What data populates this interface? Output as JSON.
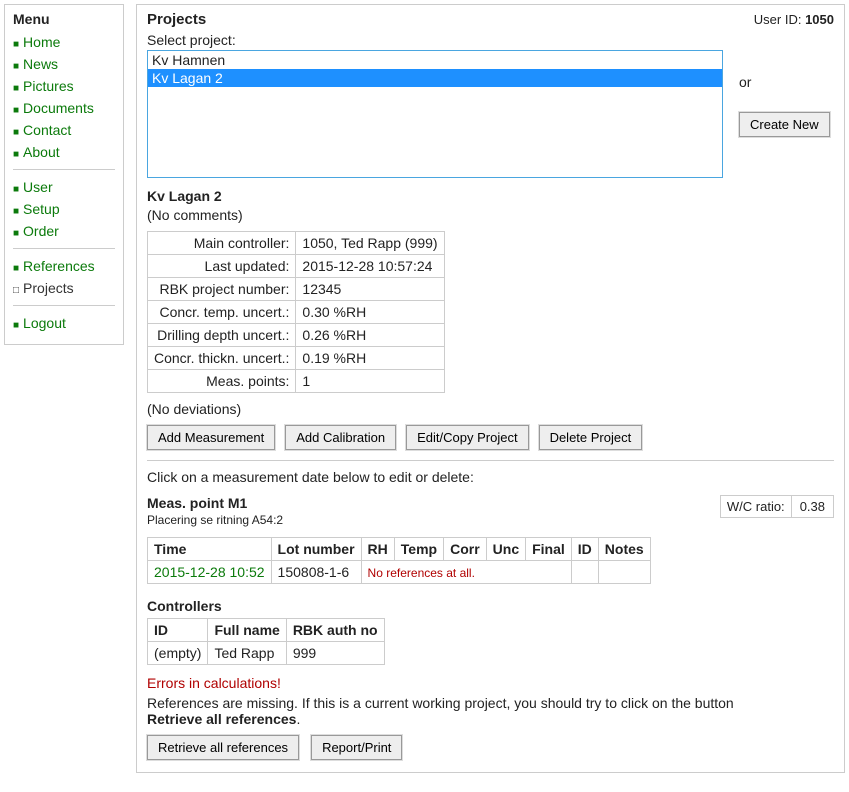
{
  "sidebar": {
    "title": "Menu",
    "groups": [
      [
        "Home",
        "News",
        "Pictures",
        "Documents",
        "Contact",
        "About"
      ],
      [
        "User",
        "Setup",
        "Order"
      ],
      [
        "References",
        "Projects"
      ],
      [
        "Logout"
      ]
    ],
    "current": "Projects"
  },
  "header": {
    "title": "Projects",
    "user_id_label": "User ID:",
    "user_id": "1050"
  },
  "select": {
    "label": "Select project:",
    "options": [
      "Kv Hamnen",
      "Kv Lagan 2"
    ],
    "selected": "Kv Lagan 2",
    "or": "or",
    "create_new": "Create New"
  },
  "project": {
    "name": "Kv Lagan 2",
    "comments": "(No comments)",
    "info_rows": [
      {
        "label": "Main controller:",
        "value": "1050, Ted Rapp (999)"
      },
      {
        "label": "Last updated:",
        "value": "2015-12-28 10:57:24"
      },
      {
        "label": "RBK project number:",
        "value": "12345"
      },
      {
        "label": "Concr. temp. uncert.:",
        "value": "0.30 %RH"
      },
      {
        "label": "Drilling depth uncert.:",
        "value": "0.26 %RH"
      },
      {
        "label": "Concr. thickn. uncert.:",
        "value": "0.19 %RH"
      },
      {
        "label": "Meas. points:",
        "value": "1"
      }
    ],
    "no_deviations": "(No deviations)"
  },
  "actions": {
    "add_measurement": "Add Measurement",
    "add_calibration": "Add Calibration",
    "edit_copy": "Edit/Copy Project",
    "delete": "Delete Project"
  },
  "meas_hint": "Click on a measurement date below to edit or delete:",
  "meas_point": {
    "title": "Meas. point M1",
    "sub": "Placering se ritning A54:2",
    "wc_label": "W/C ratio:",
    "wc_value": "0.38",
    "columns": [
      "Time",
      "Lot number",
      "RH",
      "Temp",
      "Corr",
      "Unc",
      "Final",
      "ID",
      "Notes"
    ],
    "row": {
      "time": "2015-12-28 10:52",
      "lot": "150808-1-6",
      "note": "No references at all."
    }
  },
  "controllers": {
    "title": "Controllers",
    "columns": [
      "ID",
      "Full name",
      "RBK auth no"
    ],
    "row": {
      "id": "(empty)",
      "name": "Ted Rapp",
      "auth": "999"
    }
  },
  "errors": "Errors in calculations!",
  "ref_text1": "References are missing. If this is a current working project, you should try to click on the button",
  "ref_bold": "Retrieve all references",
  "ref_period": ".",
  "bottom": {
    "retrieve": "Retrieve all references",
    "report": "Report/Print"
  }
}
